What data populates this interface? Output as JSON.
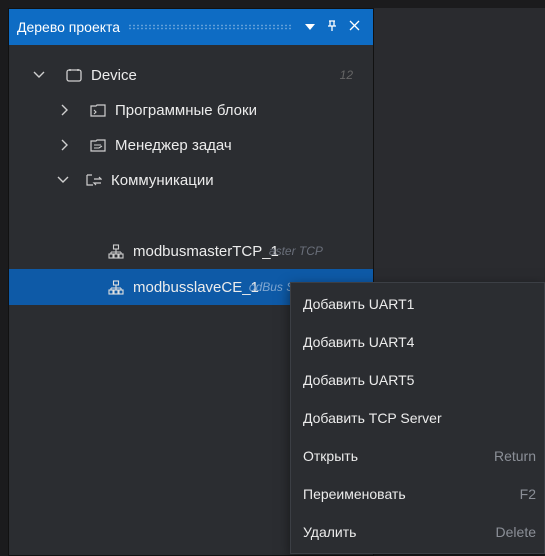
{
  "panel": {
    "title": "Дерево проекта",
    "dropdown_icon": "caret-down-icon",
    "pin_icon": "pin-icon",
    "close_icon": "close-icon"
  },
  "tree": {
    "device": {
      "label": "Device",
      "count": "12",
      "icon": "device-icon",
      "expanded": true
    },
    "program_blocks": {
      "label": "Программные блоки",
      "icon": "program-blocks-icon",
      "expanded": false
    },
    "task_manager": {
      "label": "Менеджер задач",
      "icon": "task-manager-icon",
      "expanded": false
    },
    "communications": {
      "label": "Коммуникации",
      "icon": "communications-icon",
      "expanded": true
    },
    "children": [
      {
        "label": "modbusmasterTCP_1",
        "type": "Master TCP",
        "ghost": "aster TCP",
        "icon": "network-icon"
      },
      {
        "label": "modbusslaveCE_1",
        "type": "ModBus Slave",
        "ghost": "odBus Slave",
        "icon": "network-icon",
        "selected": true
      }
    ]
  },
  "context_menu": {
    "items": [
      {
        "label": "Добавить UART1",
        "shortcut": ""
      },
      {
        "label": "Добавить UART4",
        "shortcut": ""
      },
      {
        "label": "Добавить UART5",
        "shortcut": ""
      },
      {
        "label": "Добавить TCP Server",
        "shortcut": ""
      },
      {
        "label": "Открыть",
        "shortcut": "Return"
      },
      {
        "label": "Переименовать",
        "shortcut": "F2"
      },
      {
        "label": "Удалить",
        "shortcut": "Delete"
      }
    ]
  },
  "colors": {
    "accent": "#0e6cc4",
    "selection": "#0e5aa7",
    "panel_bg": "#2b2d31"
  }
}
